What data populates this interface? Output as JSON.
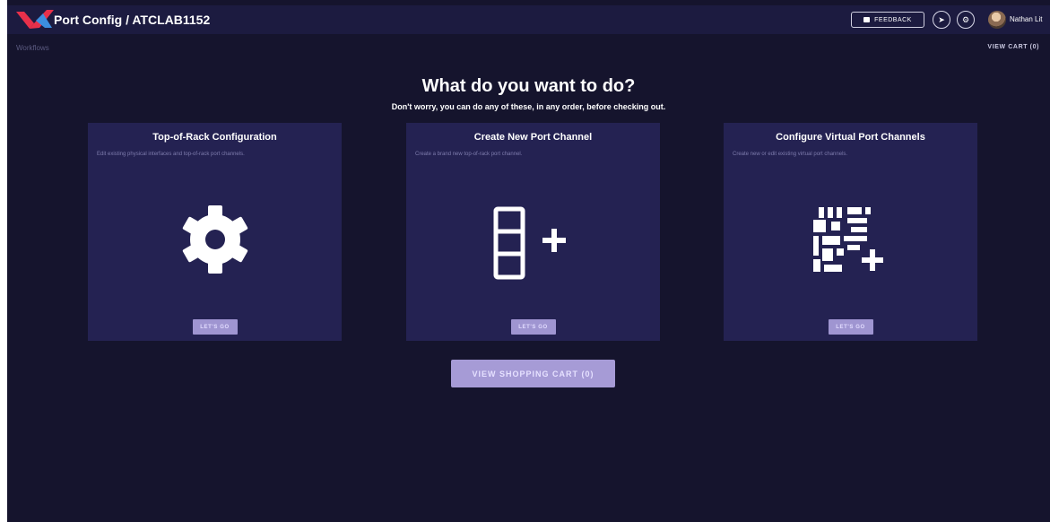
{
  "header": {
    "title": "Port Config / ATCLAB1152",
    "feedback_label": "FEEDBACK",
    "user_name": "Nathan Lit"
  },
  "breadcrumb": {
    "label": "Workflows"
  },
  "cart_link": "VIEW CART (0)",
  "main": {
    "heading": "What do you want to do?",
    "subheading": "Don't worry, you can do any of these, in any order, before checking out."
  },
  "cards": [
    {
      "title": "Top-of-Rack Configuration",
      "description": "Edit existing physical interfaces and top-of-rack port channels.",
      "icon": "gear-icon",
      "button": "LET'S GO"
    },
    {
      "title": "Create New Port Channel",
      "description": "Create a brand new top-of-rack port channel.",
      "icon": "stack-plus-icon",
      "button": "LET'S GO"
    },
    {
      "title": "Configure Virtual Port Channels",
      "description": "Create new or edit existing virtual port channels.",
      "icon": "matrix-plus-icon",
      "button": "LET'S GO"
    }
  ],
  "shopping_cart_button": "VIEW SHOPPING CART (0)",
  "colors": {
    "background": "#15142d",
    "topbar": "#1c1b40",
    "card": "#242252",
    "button": "#9f95d1",
    "logo_red": "#e8304a",
    "logo_blue": "#3c8fe0"
  }
}
